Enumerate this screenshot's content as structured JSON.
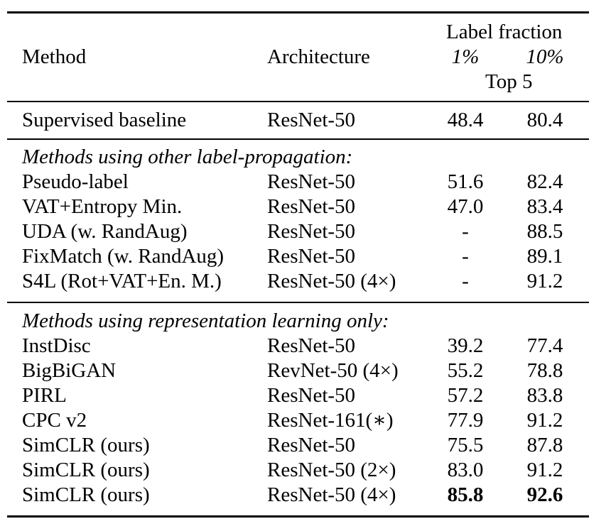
{
  "header": {
    "method": "Method",
    "architecture": "Architecture",
    "group_label": "Label fraction",
    "col_1pct": "1%",
    "col_10pct": "10%",
    "metric": "Top 5"
  },
  "baseline": {
    "method": "Supervised baseline",
    "architecture": "ResNet-50",
    "v1": "48.4",
    "v10": "80.4"
  },
  "sections": [
    {
      "title": "Methods using other label-propagation:",
      "rows": [
        {
          "method": "Pseudo-label",
          "architecture": "ResNet-50",
          "v1": "51.6",
          "v10": "82.4"
        },
        {
          "method": "VAT+Entropy Min.",
          "architecture": "ResNet-50",
          "v1": "47.0",
          "v10": "83.4"
        },
        {
          "method": "UDA (w. RandAug)",
          "architecture": "ResNet-50",
          "v1": "-",
          "v10": "88.5"
        },
        {
          "method": "FixMatch (w. RandAug)",
          "architecture": "ResNet-50",
          "v1": "-",
          "v10": "89.1"
        },
        {
          "method": "S4L (Rot+VAT+En. M.)",
          "architecture": "ResNet-50 (4×)",
          "v1": "-",
          "v10": "91.2"
        }
      ]
    },
    {
      "title": "Methods using representation learning only:",
      "rows": [
        {
          "method": "InstDisc",
          "architecture": "ResNet-50",
          "v1": "39.2",
          "v10": "77.4"
        },
        {
          "method": "BigBiGAN",
          "architecture": "RevNet-50 (4×)",
          "v1": "55.2",
          "v10": "78.8"
        },
        {
          "method": "PIRL",
          "architecture": "ResNet-50",
          "v1": "57.2",
          "v10": "83.8"
        },
        {
          "method": "CPC v2",
          "architecture": "ResNet-161(∗)",
          "v1": "77.9",
          "v10": "91.2"
        },
        {
          "method": "SimCLR (ours)",
          "architecture": "ResNet-50",
          "v1": "75.5",
          "v10": "87.8"
        },
        {
          "method": "SimCLR (ours)",
          "architecture": "ResNet-50 (2×)",
          "v1": "83.0",
          "v10": "91.2"
        },
        {
          "method": "SimCLR (ours)",
          "architecture": "ResNet-50 (4×)",
          "v1": "85.8",
          "v10": "92.6",
          "bold": true
        }
      ]
    }
  ]
}
